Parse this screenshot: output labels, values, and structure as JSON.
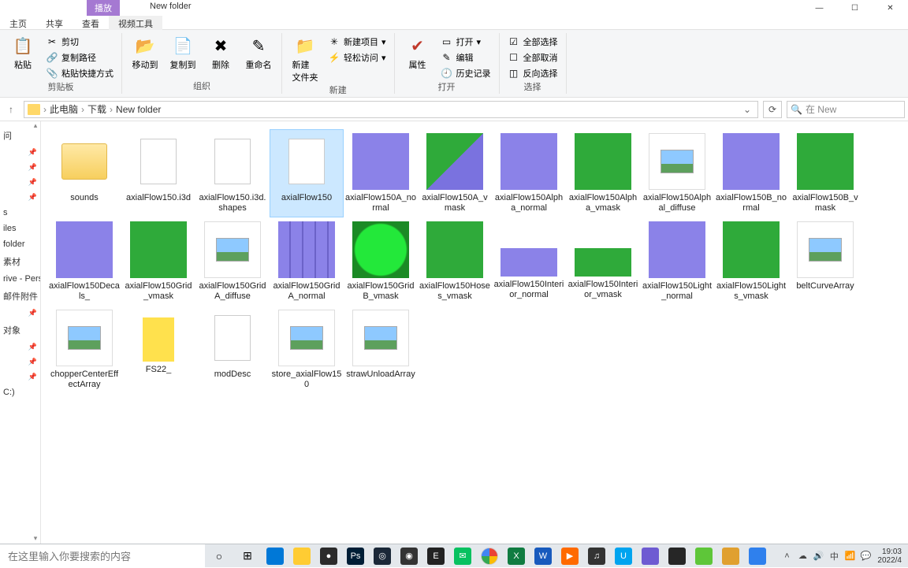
{
  "window": {
    "title": "New folder",
    "controls": {
      "min": "—",
      "max": "☐",
      "close": "✕"
    }
  },
  "tabs_context": {
    "play": "播放",
    "home": "主页",
    "share": "共享",
    "view": "查看",
    "video_tools": "视频工具"
  },
  "ribbon": {
    "clipboard": {
      "label": "剪贴板",
      "paste": "粘贴",
      "cut": "剪切",
      "copy_path": "复制路径",
      "paste_shortcut": "粘贴快捷方式"
    },
    "organize": {
      "label": "组织",
      "move_to": "移动到",
      "copy_to": "复制到",
      "delete": "删除",
      "rename": "重命名"
    },
    "new": {
      "label": "新建",
      "new_folder": "新建\n文件夹",
      "new_item": "新建项目",
      "easy_access": "轻松访问"
    },
    "open": {
      "label": "打开",
      "properties": "属性",
      "open": "打开",
      "edit": "编辑",
      "history": "历史记录"
    },
    "select": {
      "label": "选择",
      "select_all": "全部选择",
      "select_none": "全部取消",
      "invert": "反向选择"
    }
  },
  "breadcrumb": {
    "pc": "此电脑",
    "downloads": "下载",
    "folder": "New folder"
  },
  "search": {
    "placeholder": "在 New"
  },
  "sidebar": {
    "items": [
      {
        "label": "问"
      },
      {
        "label": ""
      },
      {
        "label": ""
      },
      {
        "label": ""
      },
      {
        "label": ""
      },
      {
        "label": "s"
      },
      {
        "label": "iles"
      },
      {
        "label": "folder"
      },
      {
        "label": "素材"
      },
      {
        "label": "rive - Pers"
      },
      {
        "label": "邮件附件"
      },
      {
        "label": ""
      },
      {
        "label": "对象"
      },
      {
        "label": ""
      },
      {
        "label": ""
      },
      {
        "label": ""
      },
      {
        "label": "C:)"
      }
    ]
  },
  "files": [
    {
      "name": "sounds",
      "kind": "folder"
    },
    {
      "name": "axialFlow150.i3d",
      "kind": "blank"
    },
    {
      "name": "axialFlow150.i3d.shapes",
      "kind": "blank"
    },
    {
      "name": "axialFlow150",
      "kind": "blank",
      "selected": true
    },
    {
      "name": "axialFlow150A_normal",
      "kind": "tex",
      "tex": "purple"
    },
    {
      "name": "axialFlow150A_vmask",
      "kind": "tex",
      "tex": "greenmix"
    },
    {
      "name": "axialFlow150Alpha_normal",
      "kind": "tex",
      "tex": "purple"
    },
    {
      "name": "axialFlow150Alpha_vmask",
      "kind": "tex",
      "tex": "green"
    },
    {
      "name": "axialFlow150Alphal_diffuse",
      "kind": "img"
    },
    {
      "name": "axialFlow150B_normal",
      "kind": "tex",
      "tex": "purple"
    },
    {
      "name": "axialFlow150B_vmask",
      "kind": "tex",
      "tex": "green"
    },
    {
      "name": "axialFlow150Decals_",
      "kind": "tex",
      "tex": "purple"
    },
    {
      "name": "axialFlow150Grid_vmask",
      "kind": "tex",
      "tex": "green"
    },
    {
      "name": "axialFlow150GridA_diffuse",
      "kind": "img"
    },
    {
      "name": "axialFlow150GridA_normal",
      "kind": "tex",
      "tex": "purplegrid"
    },
    {
      "name": "axialFlow150GridB_vmask",
      "kind": "tex",
      "tex": "greencircle"
    },
    {
      "name": "axialFlow150Hoses_vmask",
      "kind": "tex",
      "tex": "green"
    },
    {
      "name": "axialFlow150Interior_normal",
      "kind": "tex",
      "tex": "purplesmall"
    },
    {
      "name": "axialFlow150Interior_vmask",
      "kind": "tex",
      "tex": "greensmall"
    },
    {
      "name": "axialFlow150Light_normal",
      "kind": "tex",
      "tex": "purple"
    },
    {
      "name": "axialFlow150Lights_vmask",
      "kind": "tex",
      "tex": "green"
    },
    {
      "name": "beltCurveArray",
      "kind": "img"
    },
    {
      "name": "chopperCenterEffectArray",
      "kind": "img"
    },
    {
      "name": "FS22_",
      "kind": "tex",
      "tex": "yellowblock"
    },
    {
      "name": "modDesc",
      "kind": "blank"
    },
    {
      "name": "store_axialFlow150",
      "kind": "img"
    },
    {
      "name": "strawUnloadArray",
      "kind": "img"
    }
  ],
  "taskbar": {
    "search_placeholder": "在这里输入你要搜索的内容",
    "apps": [
      {
        "bg": "#0078d7",
        "txt": ""
      },
      {
        "bg": "#ffcc33",
        "txt": ""
      },
      {
        "bg": "#2b2b2b",
        "txt": "●"
      },
      {
        "bg": "#001e36",
        "txt": "Ps"
      },
      {
        "bg": "#1b2838",
        "txt": "◎"
      },
      {
        "bg": "#333",
        "txt": "◉"
      },
      {
        "bg": "#222",
        "txt": "E"
      },
      {
        "bg": "#07c160",
        "txt": "✉"
      },
      {
        "bg": "#fff",
        "txt": ""
      },
      {
        "bg": "#107c41",
        "txt": "X"
      },
      {
        "bg": "#185abd",
        "txt": "W"
      },
      {
        "bg": "#ff6a00",
        "txt": "▶"
      },
      {
        "bg": "#333",
        "txt": "♫"
      },
      {
        "bg": "#00a4ef",
        "txt": "U"
      },
      {
        "bg": "#6e5bd2",
        "txt": ""
      },
      {
        "bg": "#262626",
        "txt": ""
      },
      {
        "bg": "#5ec639",
        "txt": ""
      },
      {
        "bg": "#e0a030",
        "txt": ""
      },
      {
        "bg": "#2f80ed",
        "txt": ""
      }
    ],
    "clock": {
      "time": "19:03",
      "date": "2022/4"
    }
  }
}
